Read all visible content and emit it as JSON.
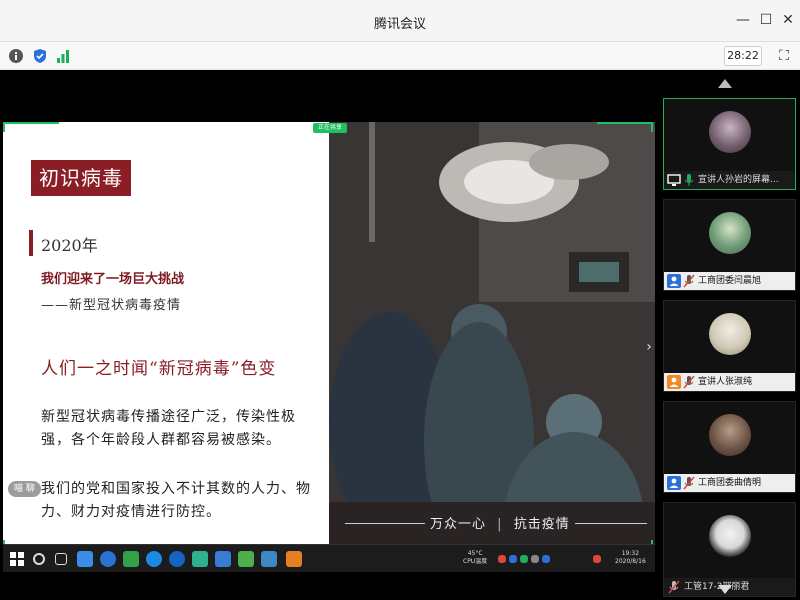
{
  "window": {
    "title": "腾讯会议",
    "minimize_icon": "minimize-icon",
    "maximize_icon": "maximize-icon",
    "close_icon": "close-icon"
  },
  "toolbar": {
    "timer": "28:22",
    "icons": [
      "info-icon",
      "shield-icon",
      "signal-icon",
      "fullscreen-icon"
    ]
  },
  "slide": {
    "header": "初识病毒",
    "year": "2020年",
    "challenge": "我们迎来了一场巨大挑战",
    "challenge_sub": "——新型冠状病毒疫情",
    "quote": "人们一之时闻“新冠病毒”色变",
    "para1": "新型冠状病毒传播途径广泛，传染性极强，各个年龄段人群都容易被感染。",
    "para2": "我们的党和国家投入不计其数的人力、物力、财力对疫情进行防控。",
    "photo_caption_left": "万众一心",
    "photo_caption_sep": "|",
    "photo_caption_right": "抗击疫情",
    "chat_label": "喵 聊",
    "top_badge": "正在共享"
  },
  "taskbar": {
    "temp": "45°C",
    "cpu_label": "CPU温度",
    "time": "19:32",
    "date": "2020/8/16"
  },
  "participants": [
    {
      "name": "宣讲人孙岩的屏幕...",
      "active": true,
      "role_color": "#222222",
      "mic_color": "#1fae59"
    },
    {
      "name": "工商团委闫晨旭",
      "active": false,
      "role_color": "#2d6fd8",
      "mic_color": "#e0443a"
    },
    {
      "name": "宣讲人张淑纯",
      "active": false,
      "role_color": "#f08a24",
      "mic_color": "#e0443a"
    },
    {
      "name": "工商团委曲倩明",
      "active": false,
      "role_color": "#2d6fd8",
      "mic_color": "#e0443a"
    },
    {
      "name": "工管17-2邢丽君",
      "active": false,
      "role_color": "#222222",
      "mic_color": "#e0443a"
    }
  ],
  "colors": {
    "accent_green": "#1fae59",
    "slide_red": "#8b1d25"
  }
}
